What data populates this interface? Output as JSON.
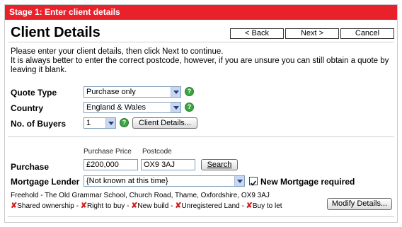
{
  "stage_banner": "Stage 1: Enter client details",
  "page_title": "Client Details",
  "nav": {
    "back": "< Back",
    "next": "Next >",
    "cancel": "Cancel"
  },
  "intro": {
    "line1": "Please enter your client details, then click Next to continue.",
    "line2": "It is always better to enter the correct postcode, however, if you are unsure you can still obtain a quote by leaving it blank."
  },
  "quote_type": {
    "label": "Quote Type",
    "value": "Purchase only"
  },
  "country": {
    "label": "Country",
    "value": "England & Wales"
  },
  "buyers": {
    "label": "No. of Buyers",
    "value": "1",
    "details_button": "Client Details..."
  },
  "help_glyph": "?",
  "purchase": {
    "label": "Purchase",
    "price_header": "Purchase Price",
    "postcode_header": "Postcode",
    "price_value": "£200,000",
    "postcode_value": "OX9 3AJ",
    "search_button": "Search"
  },
  "mortgage": {
    "label": "Mortgage Lender",
    "lender_value": "{Not known at this time}",
    "new_mortgage_label": "New Mortgage required",
    "new_mortgage_checked": true
  },
  "property_address": "Freehold - The Old Grammar School, Church Road, Thame, Oxfordshire, OX9 3AJ",
  "property_flags": [
    "Shared ownership",
    "Right to buy",
    "New build",
    "Unregistered Land",
    "Buy to let"
  ],
  "flag_separator": " - ",
  "flag_icon": "x-mark-icon",
  "modify_button": "Modify Details...",
  "colors": {
    "banner": "#e8212a",
    "help": "#3aa540",
    "flag_x": "#d42020",
    "field_border": "#7f9db9"
  }
}
